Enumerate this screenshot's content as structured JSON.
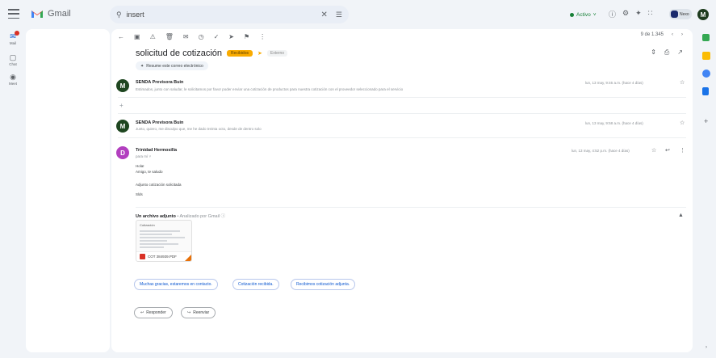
{
  "app": {
    "name": "Gmail"
  },
  "search": {
    "value": "insert"
  },
  "status": {
    "label": "Activo"
  },
  "org_badge": {
    "label": "Nexo"
  },
  "user": {
    "initial": "M"
  },
  "rail": [
    {
      "label": "Mail",
      "icon": "mail-icon"
    },
    {
      "label": "Chat",
      "icon": "chat-icon"
    },
    {
      "label": "Meet",
      "icon": "meet-icon"
    }
  ],
  "pager": {
    "range": "9 de 1.345"
  },
  "thread": {
    "subject": "solicitud de cotización",
    "label": "Recibidos",
    "label2": "Externo",
    "summary": "Resume este correo electrónico"
  },
  "messages": [
    {
      "initial": "M",
      "color": "#1e4620",
      "sender": "SENDA Previsora Buin",
      "snippet": "Estimados, junto con saludar, le solicitamos por favor poder enviar una cotización de productos para nuestra cotización con el proveedor seleccionado para el servicio",
      "date": "lun, 13 may, 9:46 a.m. (hace 4 días)"
    },
    {
      "initial": "M",
      "color": "#1e4620",
      "sender": "SENDA Previsora Buin",
      "snippet": "Junto, quiero, me disculpo que, me he dado treinta octo, desde de dentro solo",
      "date": "lun, 13 may, 9:58 a.m. (hace 4 días)"
    },
    {
      "initial": "D",
      "color": "#b23fbf",
      "sender": "Trinidad Hermosilla",
      "to": "para mí",
      "date": "lun, 13 may, 4:52 p.m. (hace 4 días)",
      "body": [
        "Hola!",
        "Amigo, te saludo",
        "Adjunto cotización solicitada",
        "Slds"
      ]
    }
  ],
  "attachment": {
    "title": "Un archivo adjunto",
    "scanned": "Analizado por Gmail",
    "preview_label": "Cotización",
    "filename": "COT 384939.PDF"
  },
  "smart_replies": [
    "Muchas gracias, estaremos en contacto.",
    "Cotización recibida.",
    "Recibimos cotización adjunta."
  ],
  "actions": {
    "reply": "Responder",
    "forward": "Reenviar"
  }
}
